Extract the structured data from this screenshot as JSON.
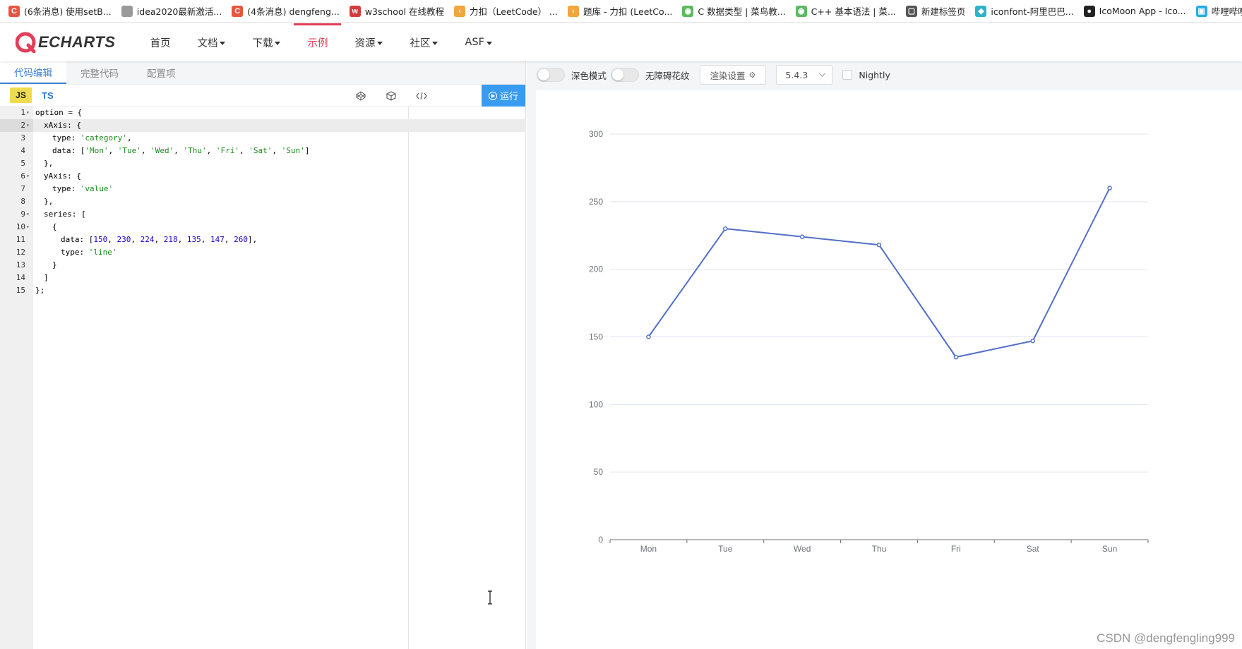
{
  "bookmarks": [
    {
      "label": "(6条消息) 使用setB...",
      "icon": "csdn-icon",
      "color": "#e8553f",
      "glyph": "C"
    },
    {
      "label": "idea2020最新激活...",
      "icon": "image-icon",
      "color": "#9a9a9a",
      "glyph": ""
    },
    {
      "label": "(4条消息) dengfeng...",
      "icon": "csdn-icon",
      "color": "#e8553f",
      "glyph": "C"
    },
    {
      "label": "w3school 在线教程",
      "icon": "w3school-icon",
      "color": "#d83b3b",
      "glyph": "w"
    },
    {
      "label": "力扣（LeetCode） ...",
      "icon": "leetcode-icon",
      "color": "#f3a63b",
      "glyph": "‹"
    },
    {
      "label": "题库 - 力扣 (LeetCo...",
      "icon": "leetcode-icon",
      "color": "#f3a63b",
      "glyph": "‹"
    },
    {
      "label": "C 数据类型 | 菜鸟教...",
      "icon": "runoob-icon",
      "color": "#5fb85f",
      "glyph": "◉"
    },
    {
      "label": "C++ 基本语法 | 菜...",
      "icon": "runoob-icon",
      "color": "#5fb85f",
      "glyph": "◉"
    },
    {
      "label": "新建标签页",
      "icon": "newtab-icon",
      "color": "#555555",
      "glyph": "▢"
    },
    {
      "label": "iconfont-阿里巴巴...",
      "icon": "iconfont-icon",
      "color": "#2bb3c9",
      "glyph": "◆"
    },
    {
      "label": "IcoMoon App - Ico...",
      "icon": "icomoon-icon",
      "color": "#222222",
      "glyph": "●"
    },
    {
      "label": "哔哩哔哩 ( ゜- ゜)つ...",
      "icon": "bilibili-icon",
      "color": "#23ade5",
      "glyph": "▣"
    }
  ],
  "nav": {
    "logo": "ECHARTS",
    "items": [
      {
        "label": "首页",
        "dropdown": false,
        "active": false
      },
      {
        "label": "文档",
        "dropdown": true,
        "active": false
      },
      {
        "label": "下载",
        "dropdown": true,
        "active": false
      },
      {
        "label": "示例",
        "dropdown": false,
        "active": true
      },
      {
        "label": "资源",
        "dropdown": true,
        "active": false
      },
      {
        "label": "社区",
        "dropdown": true,
        "active": false
      },
      {
        "label": "ASF",
        "dropdown": true,
        "active": false
      }
    ]
  },
  "editor": {
    "tabs": [
      {
        "label": "代码编辑",
        "active": true
      },
      {
        "label": "完整代码",
        "active": false
      },
      {
        "label": "配置项",
        "active": false
      }
    ],
    "lang_js": "JS",
    "lang_ts": "TS",
    "tool_icons": [
      "codepen-icon",
      "codesandbox-icon",
      "code-format-icon"
    ],
    "run_label": "运行",
    "highlighted_line": 2,
    "code_lines": [
      {
        "n": "1",
        "fold": true,
        "indent": 0,
        "parts": [
          [
            "p",
            "option = {"
          ]
        ]
      },
      {
        "n": "2",
        "fold": true,
        "indent": 1,
        "parts": [
          [
            "p",
            "xAxis: {"
          ]
        ]
      },
      {
        "n": "3",
        "fold": false,
        "indent": 2,
        "parts": [
          [
            "p",
            "type: "
          ],
          [
            "s",
            "'category'"
          ],
          [
            "p",
            ","
          ]
        ]
      },
      {
        "n": "4",
        "fold": false,
        "indent": 2,
        "parts": [
          [
            "p",
            "data: ["
          ],
          [
            "s",
            "'Mon'"
          ],
          [
            "p",
            ", "
          ],
          [
            "s",
            "'Tue'"
          ],
          [
            "p",
            ", "
          ],
          [
            "s",
            "'Wed'"
          ],
          [
            "p",
            ", "
          ],
          [
            "s",
            "'Thu'"
          ],
          [
            "p",
            ", "
          ],
          [
            "s",
            "'Fri'"
          ],
          [
            "p",
            ", "
          ],
          [
            "s",
            "'Sat'"
          ],
          [
            "p",
            ", "
          ],
          [
            "s",
            "'Sun'"
          ],
          [
            "p",
            "]"
          ]
        ]
      },
      {
        "n": "5",
        "fold": false,
        "indent": 1,
        "parts": [
          [
            "p",
            "},"
          ]
        ]
      },
      {
        "n": "6",
        "fold": true,
        "indent": 1,
        "parts": [
          [
            "p",
            "yAxis: {"
          ]
        ]
      },
      {
        "n": "7",
        "fold": false,
        "indent": 2,
        "parts": [
          [
            "p",
            "type: "
          ],
          [
            "s",
            "'value'"
          ]
        ]
      },
      {
        "n": "8",
        "fold": false,
        "indent": 1,
        "parts": [
          [
            "p",
            "},"
          ]
        ]
      },
      {
        "n": "9",
        "fold": true,
        "indent": 1,
        "parts": [
          [
            "p",
            "series: ["
          ]
        ]
      },
      {
        "n": "10",
        "fold": true,
        "indent": 2,
        "parts": [
          [
            "p",
            "{"
          ]
        ]
      },
      {
        "n": "11",
        "fold": false,
        "indent": 3,
        "parts": [
          [
            "p",
            "data: ["
          ],
          [
            "n",
            "150"
          ],
          [
            "p",
            ", "
          ],
          [
            "n",
            "230"
          ],
          [
            "p",
            ", "
          ],
          [
            "n",
            "224"
          ],
          [
            "p",
            ", "
          ],
          [
            "n",
            "218"
          ],
          [
            "p",
            ", "
          ],
          [
            "n",
            "135"
          ],
          [
            "p",
            ", "
          ],
          [
            "n",
            "147"
          ],
          [
            "p",
            ", "
          ],
          [
            "n",
            "260"
          ],
          [
            "p",
            "],"
          ]
        ]
      },
      {
        "n": "12",
        "fold": false,
        "indent": 3,
        "parts": [
          [
            "p",
            "type: "
          ],
          [
            "s",
            "'line'"
          ]
        ]
      },
      {
        "n": "13",
        "fold": false,
        "indent": 2,
        "parts": [
          [
            "p",
            "}"
          ]
        ]
      },
      {
        "n": "14",
        "fold": false,
        "indent": 1,
        "parts": [
          [
            "p",
            "]"
          ]
        ]
      },
      {
        "n": "15",
        "fold": false,
        "indent": 0,
        "parts": [
          [
            "p",
            "};"
          ]
        ]
      }
    ]
  },
  "preview": {
    "dark_mode_label": "深色模式",
    "decal_label": "无障碍花纹",
    "render_settings_label": "渲染设置",
    "version": "5.4.3",
    "nightly_label": "Nightly"
  },
  "chart_data": {
    "type": "line",
    "categories": [
      "Mon",
      "Tue",
      "Wed",
      "Thu",
      "Fri",
      "Sat",
      "Sun"
    ],
    "series": [
      {
        "values": [
          150,
          230,
          224,
          218,
          135,
          147,
          260
        ],
        "color": "#5470c6"
      }
    ],
    "ylim": [
      0,
      300
    ],
    "yticks": [
      0,
      50,
      100,
      150,
      200,
      250,
      300
    ],
    "grid": true
  },
  "watermark": "CSDN @dengfengling999"
}
